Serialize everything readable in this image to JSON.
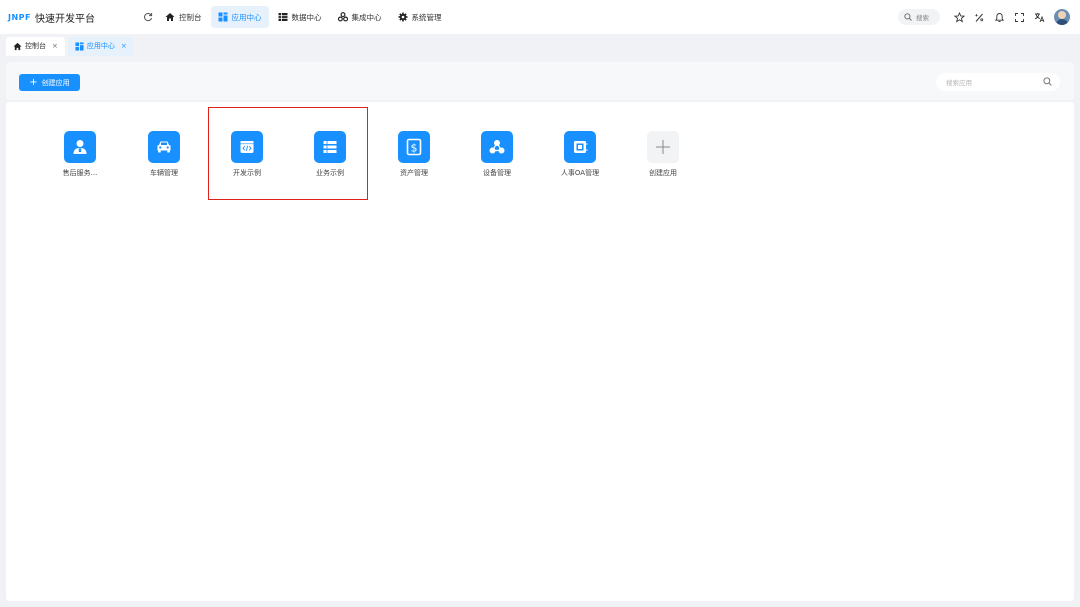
{
  "header": {
    "brand": "JNPF",
    "title": "快速开发平台",
    "nav": [
      {
        "label": "控制台",
        "icon": "home-icon"
      },
      {
        "label": "应用中心",
        "icon": "app-grid-icon",
        "active": true
      },
      {
        "label": "数据中心",
        "icon": "table-icon"
      },
      {
        "label": "集成中心",
        "icon": "integration-icon"
      },
      {
        "label": "系统管理",
        "icon": "gear-icon"
      }
    ],
    "search_label": "搜索"
  },
  "tabs": [
    {
      "label": "控制台",
      "icon": "home-icon"
    },
    {
      "label": "应用中心",
      "icon": "app-grid-icon",
      "active": true
    }
  ],
  "toolbar": {
    "create_label": "创建应用",
    "search_placeholder": "搜索应用"
  },
  "apps": [
    {
      "label": "售后服务...",
      "icon": "person-icon"
    },
    {
      "label": "车辆管理",
      "icon": "car-icon"
    },
    {
      "label": "开发示例",
      "icon": "code-icon"
    },
    {
      "label": "业务示例",
      "icon": "list-icon"
    },
    {
      "label": "资产管理",
      "icon": "dollar-icon"
    },
    {
      "label": "设备管理",
      "icon": "nodes-icon"
    },
    {
      "label": "人事OA管理",
      "icon": "cabinet-icon"
    },
    {
      "label": "创建应用",
      "icon": "plus-icon"
    }
  ],
  "colors": {
    "primary": "#1890ff",
    "highlight_border": "#e0211b",
    "active_tab_bg": "#e6f1fb"
  }
}
